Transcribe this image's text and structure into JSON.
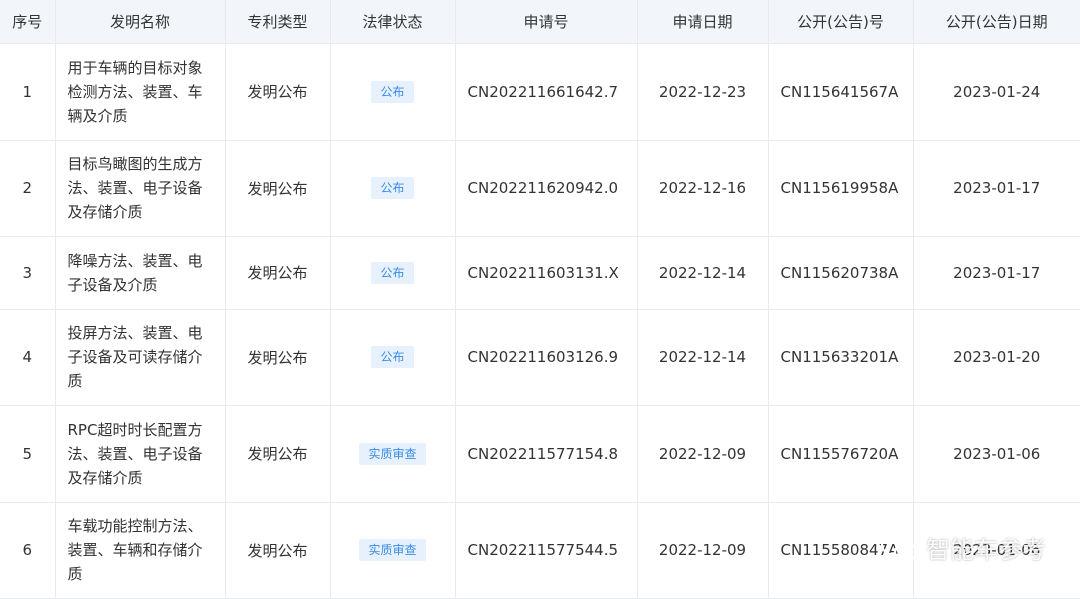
{
  "headers": [
    "序号",
    "发明名称",
    "专利类型",
    "法律状态",
    "申请号",
    "申请日期",
    "公开(公告)号",
    "公开(公告)日期"
  ],
  "rows": [
    {
      "no": "1",
      "name": "用于车辆的目标对象检测方法、装置、车辆及介质",
      "type": "发明公布",
      "status": "公布",
      "app_no": "CN202211661642.7",
      "app_date": "2022-12-23",
      "pub_no": "CN115641567A",
      "pub_date": "2023-01-24"
    },
    {
      "no": "2",
      "name": "目标鸟瞰图的生成方法、装置、电子设备及存储介质",
      "type": "发明公布",
      "status": "公布",
      "app_no": "CN202211620942.0",
      "app_date": "2022-12-16",
      "pub_no": "CN115619958A",
      "pub_date": "2023-01-17"
    },
    {
      "no": "3",
      "name": "降噪方法、装置、电子设备及介质",
      "type": "发明公布",
      "status": "公布",
      "app_no": "CN202211603131.X",
      "app_date": "2022-12-14",
      "pub_no": "CN115620738A",
      "pub_date": "2023-01-17"
    },
    {
      "no": "4",
      "name": "投屏方法、装置、电子设备及可读存储介质",
      "type": "发明公布",
      "status": "公布",
      "app_no": "CN202211603126.9",
      "app_date": "2022-12-14",
      "pub_no": "CN115633201A",
      "pub_date": "2023-01-20"
    },
    {
      "no": "5",
      "name": "RPC超时时长配置方法、装置、电子设备及存储介质",
      "type": "发明公布",
      "status": "实质审查",
      "app_no": "CN202211577154.8",
      "app_date": "2022-12-09",
      "pub_no": "CN115576720A",
      "pub_date": "2023-01-06"
    },
    {
      "no": "6",
      "name": "车载功能控制方法、装置、车辆和存储介质",
      "type": "发明公布",
      "status": "实质审查",
      "app_no": "CN202211577544.5",
      "app_date": "2022-12-09",
      "pub_no": "CN115580847A",
      "pub_date": "2023-01-06"
    }
  ],
  "watermark": "智能车参考",
  "colors": {
    "header_bg": "#f2f6fb",
    "border": "#e6ebf2",
    "badge_bg": "#e6f1fd",
    "badge_text": "#3b8ce8"
  }
}
